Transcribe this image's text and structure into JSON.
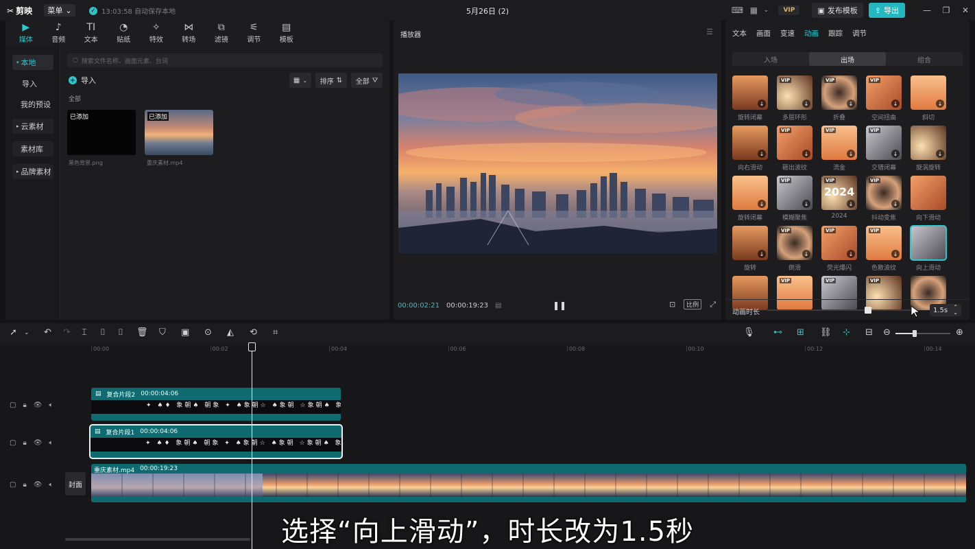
{
  "app": {
    "name": "剪映",
    "menu_label": "菜单",
    "autosave_text": "13:03:58 自动保存本地",
    "doc_title": "5月26日 (2)",
    "vip_label": "VIP",
    "publish_label": "发布模板",
    "export_label": "导出"
  },
  "media_tabs": [
    {
      "label": "媒体",
      "icon": "media-icon",
      "active": true
    },
    {
      "label": "音频",
      "icon": "audio-icon"
    },
    {
      "label": "文本",
      "icon": "text-icon"
    },
    {
      "label": "贴纸",
      "icon": "sticker-icon"
    },
    {
      "label": "特效",
      "icon": "effects-icon"
    },
    {
      "label": "转场",
      "icon": "transition-icon"
    },
    {
      "label": "滤镜",
      "icon": "filter-icon"
    },
    {
      "label": "调节",
      "icon": "adjust-icon"
    },
    {
      "label": "模板",
      "icon": "template-icon"
    }
  ],
  "sidebar": {
    "items": [
      "本地",
      "导入",
      "我的预设",
      "云素材",
      "素材库",
      "品牌素材"
    ]
  },
  "media": {
    "search_placeholder": "搜索文件名称、画面元素、台词",
    "import_label": "导入",
    "sort_label": "排序",
    "filter_label": "全部",
    "section_label": "全部",
    "files": [
      {
        "tag": "已添加",
        "name": "黑色背景.png"
      },
      {
        "tag": "已添加",
        "name": "重庆素材.mp4"
      }
    ]
  },
  "player": {
    "title": "播放器",
    "current_time": "00:00:02:21",
    "total_time": "00:00:19:23",
    "ratio_label": "比例"
  },
  "properties": {
    "tabs": [
      "文本",
      "画面",
      "变速",
      "动画",
      "跟踪",
      "调节"
    ],
    "active_tab": "动画",
    "segments": [
      "入场",
      "出场",
      "组合"
    ],
    "active_segment": "出场",
    "animations": [
      {
        "label": "旋转闭幕",
        "vip": false,
        "dl": true
      },
      {
        "label": "多层环形",
        "vip": true,
        "dl": true
      },
      {
        "label": "折叠",
        "vip": true,
        "dl": true
      },
      {
        "label": "空间扭曲",
        "vip": true,
        "dl": true
      },
      {
        "label": "斜切",
        "vip": false,
        "dl": true
      },
      {
        "label": "向右滑动",
        "vip": false,
        "dl": true
      },
      {
        "label": "砸出波纹",
        "vip": true,
        "dl": true
      },
      {
        "label": "流金",
        "vip": true,
        "dl": true
      },
      {
        "label": "交错闭幕",
        "vip": true,
        "dl": true
      },
      {
        "label": "旋涡旋转",
        "vip": false,
        "dl": true
      },
      {
        "label": "旋转闭幕",
        "vip": false,
        "dl": true
      },
      {
        "label": "模糊聚焦",
        "vip": true,
        "dl": true
      },
      {
        "label": "2024",
        "vip": true,
        "dl": true,
        "big": "2024"
      },
      {
        "label": "抖动变焦",
        "vip": true,
        "dl": true
      },
      {
        "label": "向下滑动",
        "vip": false,
        "dl": false
      },
      {
        "label": "旋转",
        "vip": false,
        "dl": true
      },
      {
        "label": "倒滑",
        "vip": true,
        "dl": true
      },
      {
        "label": "荧光爆闪",
        "vip": true,
        "dl": true
      },
      {
        "label": "色散波纹",
        "vip": true,
        "dl": true
      },
      {
        "label": "向上滑动",
        "vip": false,
        "dl": false,
        "selected": true
      },
      {
        "label": "",
        "vip": false,
        "dl": false
      },
      {
        "label": "",
        "vip": true,
        "dl": false
      },
      {
        "label": "",
        "vip": true,
        "dl": false
      },
      {
        "label": "",
        "vip": true,
        "dl": false
      },
      {
        "label": "",
        "vip": false,
        "dl": false
      }
    ],
    "duration_label": "动画时长",
    "duration_value": "1.5s",
    "duration_fraction": 0.68
  },
  "timeline": {
    "ruler": [
      "00:00",
      "00:02",
      "00:04",
      "00:06",
      "00:08",
      "00:10",
      "00:12",
      "00:14"
    ],
    "clips": [
      {
        "name": "复合片段2",
        "duration": "00:00:04:06",
        "selected": false
      },
      {
        "name": "复合片段1",
        "duration": "00:00:04:06",
        "selected": true
      }
    ],
    "wave_text": "✦  ♠♦ 象朝♠ 朝象 ✦ ♠象朝☆ ♠象朝 ☆象朝♠  象朝♠♠象朝♠",
    "video": {
      "name": "重庆素材.mp4",
      "duration": "00:00:19:23"
    },
    "cover_label": "封面"
  },
  "subtitle": "选择“向上滑动”，时长改为1.5秒",
  "colors": {
    "accent": "#2ec6cd",
    "clip": "#0f6b6f",
    "background": "#141416"
  }
}
